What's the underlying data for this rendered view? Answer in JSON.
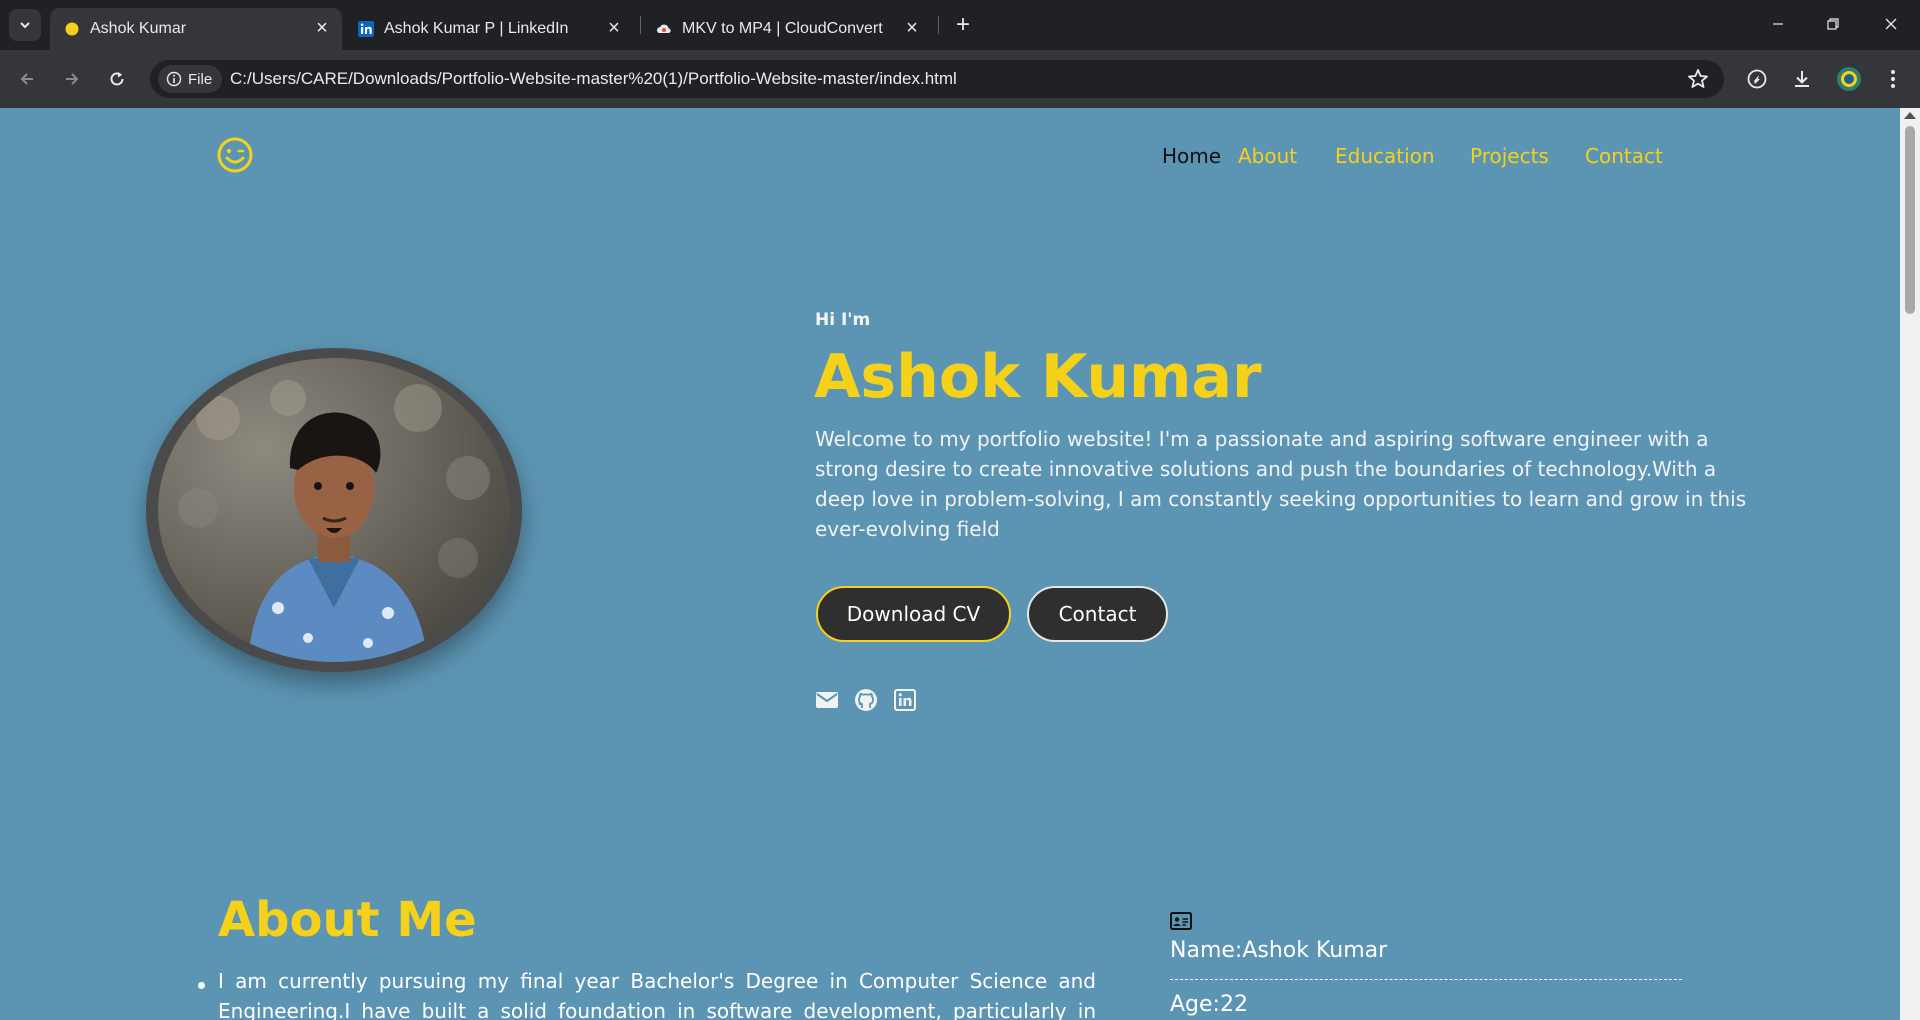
{
  "browser": {
    "tabs": [
      {
        "title": "Ashok Kumar",
        "active": true
      },
      {
        "title": "Ashok Kumar P | LinkedIn",
        "active": false
      },
      {
        "title": "MKV to MP4 | CloudConvert",
        "active": false
      }
    ],
    "address": {
      "chip_label": "File",
      "url": "C:/Users/CARE/Downloads/Portfolio-Website-master%20(1)/Portfolio-Website-master/index.html"
    }
  },
  "site": {
    "nav": [
      "Home",
      "About",
      "Education",
      "Projects",
      "Contact"
    ],
    "hero": {
      "greeting": "Hi I'm",
      "name": "Ashok Kumar",
      "intro": "Welcome to my portfolio website! I'm a passionate and aspiring software engineer with a strong desire to create innovative solutions and push the boundaries of technology.With a deep love in problem-solving, I am constantly seeking opportunities to learn and grow in this ever-evolving field",
      "download_cv": "Download CV",
      "contact": "Contact"
    },
    "about": {
      "title": "About Me",
      "text": "I am currently pursuing my final year Bachelor's Degree in Computer Science and Engineering.I have built a solid foundation in software development, particularly in areas",
      "info_name": "Name:Ashok Kumar",
      "info_age": "Age:22"
    }
  },
  "colors": {
    "page_bg": "#5c95b3",
    "accent": "#f6d11a",
    "button_bg": "#2f2f2f"
  },
  "icons": [
    "search-tabs-icon",
    "linkedin-icon",
    "cloudconvert-icon",
    "email-icon",
    "github-icon",
    "linkedin-social-icon",
    "id-card-icon",
    "smile-logo-icon"
  ]
}
